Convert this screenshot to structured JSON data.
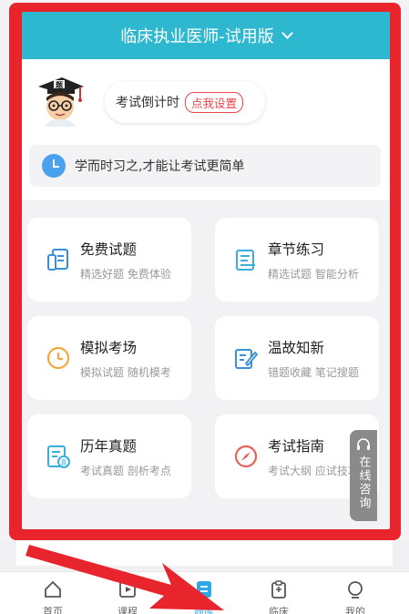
{
  "header": {
    "title": "临床执业医师-试用版"
  },
  "countdown": {
    "label": "考试倒计时",
    "set_label": "点我设置"
  },
  "motto": {
    "text": "学而时习之,才能让考试更简单"
  },
  "cards": [
    {
      "title": "免费试题",
      "subtitle": "精选好题 免费体验",
      "icon": "document-icon"
    },
    {
      "title": "章节练习",
      "subtitle": "精选试题 智能分析",
      "icon": "notebook-icon"
    },
    {
      "title": "模拟考场",
      "subtitle": "模拟试题 随机模考",
      "icon": "clock-icon"
    },
    {
      "title": "温故知新",
      "subtitle": "错题收藏 笔记搜题",
      "icon": "edit-note-icon"
    },
    {
      "title": "历年真题",
      "subtitle": "考试真题 剖析考点",
      "icon": "exam-paper-icon"
    },
    {
      "title": "考试指南",
      "subtitle": "考试大纲 应试技巧",
      "icon": "compass-icon"
    }
  ],
  "consult": {
    "label": "在线咨询"
  },
  "tabs": [
    {
      "label": "首页",
      "icon": "home-icon"
    },
    {
      "label": "课程",
      "icon": "course-icon"
    },
    {
      "label": "题库",
      "icon": "question-bank-icon",
      "active": true
    },
    {
      "label": "临床",
      "icon": "clipboard-icon"
    },
    {
      "label": "我的",
      "icon": "profile-icon"
    }
  ],
  "colors": {
    "header": "#2eb8cf",
    "highlight_frame": "#e8242c",
    "accent": "#2ea8e6",
    "badge": "#e8444a"
  }
}
